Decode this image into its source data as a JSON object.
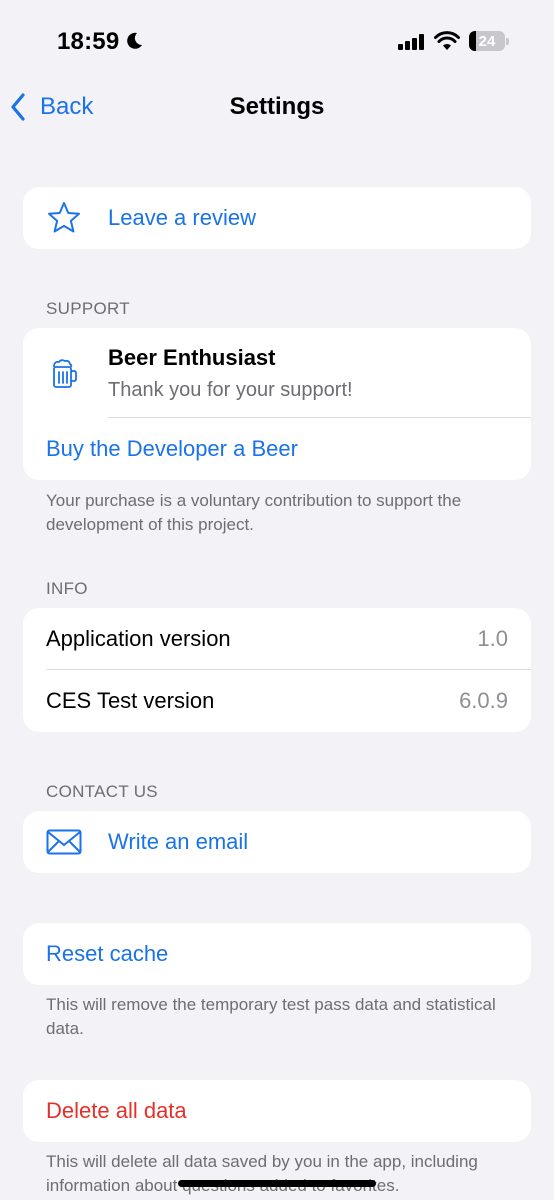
{
  "status_bar": {
    "time": "18:59",
    "battery": "24"
  },
  "nav": {
    "back_label": "Back",
    "title": "Settings"
  },
  "review": {
    "label": "Leave a review",
    "icon": "star-icon"
  },
  "support": {
    "header": "SUPPORT",
    "tier_title": "Beer Enthusiast",
    "tier_subtitle": "Thank you for your support!",
    "tier_icon": "beer-mug-icon",
    "buy_label": "Buy the Developer a Beer",
    "footer": "Your purchase is a voluntary contribution to support the development of this project."
  },
  "info": {
    "header": "INFO",
    "rows": [
      {
        "label": "Application version",
        "value": "1.0"
      },
      {
        "label": "CES Test version",
        "value": "6.0.9"
      }
    ]
  },
  "contact": {
    "header": "CONTACT US",
    "email_label": "Write an email",
    "icon": "envelope-icon"
  },
  "reset": {
    "label": "Reset cache",
    "footer": "This will remove the temporary test pass data and statistical data."
  },
  "delete": {
    "label": "Delete all data",
    "footer": "This will delete all data saved by you in the app, including information about questions added to favorites."
  },
  "colors": {
    "accent": "#1a73e8",
    "destructive": "#e5302a",
    "background": "#f2f2f7",
    "secondary_text": "#6d6d72"
  }
}
